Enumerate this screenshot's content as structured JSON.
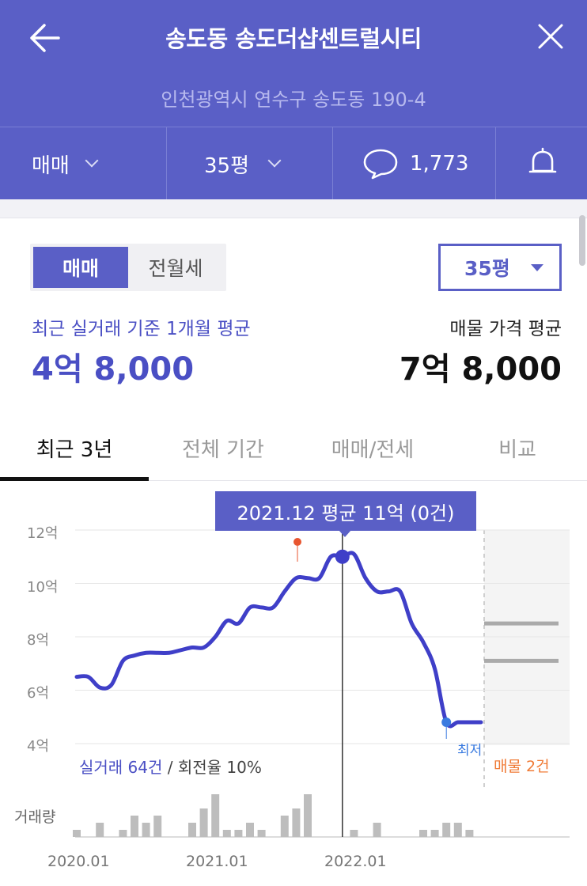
{
  "header": {
    "title": "송도동 송도더샵센트럴시티",
    "address": "인천광역시 연수구 송도동 190-4",
    "trade_type": "매매",
    "size": "35평",
    "comment_count": "1,773"
  },
  "segment": {
    "active": "매매",
    "inactive": "전월세"
  },
  "size_select": "35평",
  "summary": {
    "left_label": "최근 실거래 기준 1개월 평균",
    "left_value": "4억 8,000",
    "right_label": "매물 가격 평균",
    "right_value": "7억 8,000"
  },
  "tabs": [
    "최근 3년",
    "전체 기간",
    "매매/전세",
    "비교"
  ],
  "tooltip": "2021.12 평균 11억 (0건)",
  "deal_info": {
    "count": "실거래 64건",
    "turnover": " / 회전율 10%"
  },
  "listing_label": "매물 2건",
  "lowest_label": "최저",
  "volume_label": "거래량",
  "colors": {
    "brand": "#5a5fc6",
    "line": "#3f3fc8",
    "high_point": "#e8552f",
    "low_point": "#3a7be0",
    "listing": "#f07b36"
  },
  "chart_data": {
    "type": "line",
    "y_unit": "억",
    "yticks": [
      "12억",
      "10억",
      "8억",
      "6억",
      "4억"
    ],
    "xticks": [
      "2020.01",
      "2021.01",
      "2022.01"
    ],
    "ylim": [
      4,
      12
    ],
    "series": [
      {
        "x": [
          "2020.01",
          "2020.02",
          "2020.03",
          "2020.04",
          "2020.05",
          "2020.06",
          "2020.07",
          "2020.08",
          "2020.09",
          "2020.10",
          "2020.11",
          "2020.12",
          "2021.01",
          "2021.02",
          "2021.03",
          "2021.04",
          "2021.05",
          "2021.06",
          "2021.07",
          "2021.08",
          "2021.09",
          "2021.10",
          "2021.11",
          "2021.12",
          "2022.01",
          "2022.02",
          "2022.03",
          "2022.04",
          "2022.05",
          "2022.06",
          "2022.07",
          "2022.08",
          "2022.09",
          "2022.10",
          "2022.11",
          "2022.12"
        ],
        "values": [
          6.5,
          6.5,
          6.1,
          6.2,
          7.1,
          7.3,
          7.4,
          7.4,
          7.4,
          7.5,
          7.6,
          7.6,
          8.0,
          8.6,
          8.5,
          9.1,
          9.1,
          9.1,
          9.7,
          10.2,
          10.2,
          10.2,
          11.0,
          11.0,
          11.1,
          10.2,
          9.7,
          9.7,
          9.7,
          8.5,
          7.8,
          6.8,
          4.8,
          4.8,
          4.8,
          4.8
        ]
      }
    ],
    "listings": [
      8.5,
      7.1
    ],
    "volume": [
      1,
      0,
      2,
      0,
      1,
      3,
      2,
      3,
      0,
      0,
      2,
      4,
      6,
      1,
      1,
      2,
      1,
      0,
      3,
      4,
      6,
      0,
      0,
      0,
      1,
      0,
      2,
      0,
      0,
      0,
      1,
      1,
      2,
      2,
      1,
      0
    ]
  }
}
